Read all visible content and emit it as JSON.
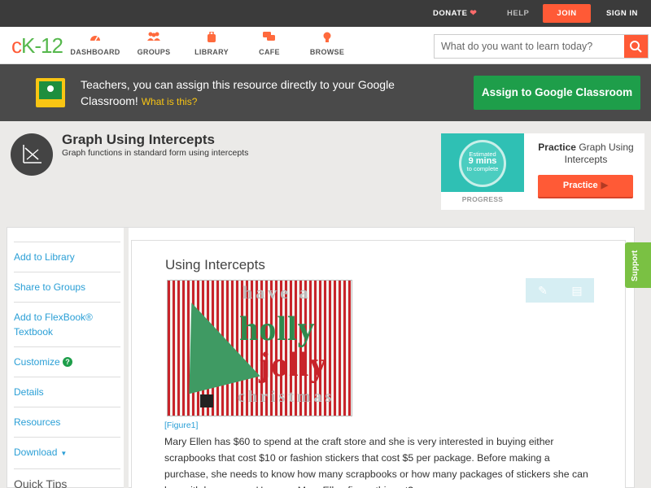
{
  "topbar": {
    "donate": "DONATE",
    "help": "HELP",
    "join": "JOIN",
    "signin": "SIGN IN"
  },
  "nav": {
    "logo": {
      "c": "c",
      "k": "K",
      "t": "-12"
    },
    "items": [
      {
        "label": "DASHBOARD",
        "icon": "dashboard-gauge-icon"
      },
      {
        "label": "GROUPS",
        "icon": "groups-people-icon"
      },
      {
        "label": "LIBRARY",
        "icon": "library-bag-icon"
      },
      {
        "label": "CAFE",
        "icon": "cafe-chat-icon"
      },
      {
        "label": "BROWSE",
        "icon": "browse-bulb-icon"
      }
    ],
    "search_placeholder": "What do you want to learn today?"
  },
  "banner": {
    "text": "Teachers, you can assign this resource directly to your Google Classroom!",
    "what": "What is this?",
    "button": "Assign to Google Classroom"
  },
  "concept": {
    "title": "Graph Using Intercepts",
    "subtitle": "Graph functions in standard form using intercepts"
  },
  "practice": {
    "estimated": "Estimated",
    "mins": "9 mins",
    "complete": "to complete",
    "progress": "PROGRESS",
    "lead": "Practice",
    "name": "Graph Using Intercepts",
    "button": "Practice"
  },
  "sidebar": {
    "items": [
      "Add to Library",
      "Share to Groups",
      "Add to FlexBook® Textbook",
      "Customize",
      "Details",
      "Resources",
      "Download"
    ],
    "quick_tips": "Quick Tips"
  },
  "article": {
    "title": "Using Intercepts",
    "figure_caption": "[Figure1]",
    "figure_words": [
      "have a",
      "holly",
      "jolly",
      "christmas"
    ],
    "body": "Mary Ellen has $60 to spend at the craft store and she is very interested in buying either scrapbooks that cost $10 or fashion stickers that cost $5 per package. Before making a purchase, she needs to know how many scrapbooks or how many packages of stickers she can buy with her money. How can Mary Ellen figure this out?"
  },
  "support": "Support",
  "colors": {
    "accent": "#ff5a36",
    "green": "#1e9e4a",
    "link": "#2a9fd6",
    "teal": "#2fc0b4"
  }
}
